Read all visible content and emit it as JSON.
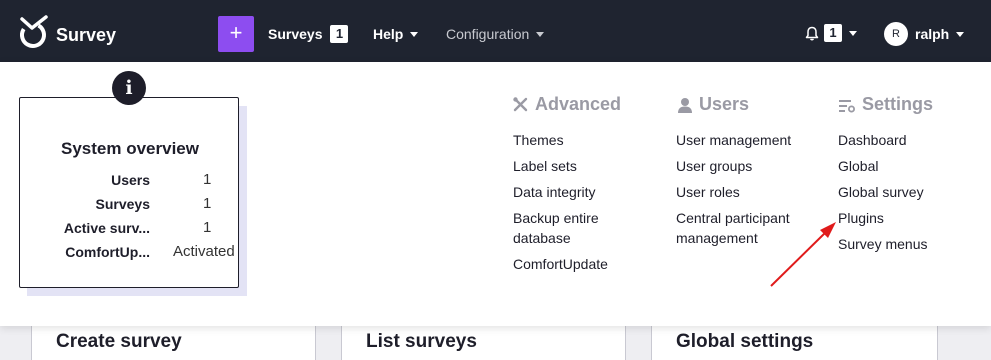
{
  "navbar": {
    "brand": "Survey",
    "add_label": "+",
    "surveys_label": "Surveys",
    "surveys_count": "1",
    "help_label": "Help",
    "configuration_label": "Configuration",
    "notifications_count": "1",
    "user_initial": "R",
    "user_name": "ralph"
  },
  "overview": {
    "info_glyph": "i",
    "title": "System overview",
    "rows": [
      {
        "label": "Users",
        "value": "1"
      },
      {
        "label": "Surveys",
        "value": "1"
      },
      {
        "label": "Active surv...",
        "value": "1"
      },
      {
        "label": "ComfortUp...",
        "value": "Activated"
      }
    ]
  },
  "menu": {
    "advanced": {
      "heading": "Advanced",
      "icon": "tools-icon",
      "items": [
        "Themes",
        "Label sets",
        "Data integrity",
        "Backup entire",
        "database",
        "ComfortUpdate"
      ]
    },
    "users": {
      "heading": "Users",
      "icon": "user-icon",
      "items": [
        "User management",
        "User groups",
        "User roles",
        "Central participant",
        "management"
      ]
    },
    "settings": {
      "heading": "Settings",
      "icon": "settings-list-icon",
      "items": [
        "Dashboard",
        "Global",
        "Global survey",
        "Plugins",
        "Survey menus"
      ]
    }
  },
  "cards": [
    "Create survey",
    "List surveys",
    "Global settings"
  ],
  "colors": {
    "navbar": "#1f2430",
    "accent": "#8d4df0",
    "annotation_arrow": "#e01b1b"
  }
}
